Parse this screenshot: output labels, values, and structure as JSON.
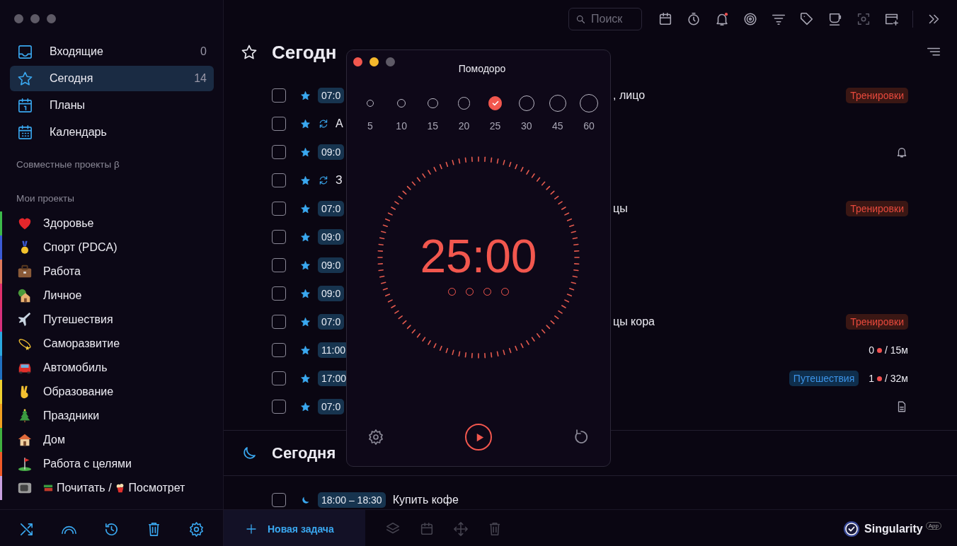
{
  "sidebar": {
    "nav": [
      {
        "label": "Входящие",
        "count": "0",
        "selected": false
      },
      {
        "label": "Сегодня",
        "count": "14",
        "selected": true
      },
      {
        "label": "Планы",
        "selected": false
      },
      {
        "label": "Календарь",
        "selected": false
      }
    ],
    "shared_label": "Совместные проекты β",
    "projects_label": "Мои проекты",
    "projects": [
      {
        "name": "Здоровье",
        "color": "#3cb94a"
      },
      {
        "name": "Спорт (PDCA)",
        "color": "#3b5bd6"
      },
      {
        "name": "Работа",
        "color": "#e07a5c"
      },
      {
        "name": "Личное",
        "color": "#e0306c"
      },
      {
        "name": "Путешествия",
        "color": "#d6307c"
      },
      {
        "name": "Саморазвитие",
        "color": "#2ba8e0"
      },
      {
        "name": "Автомобиль",
        "color": "#2070c0"
      },
      {
        "name": "Образование",
        "color": "#f0d030"
      },
      {
        "name": "Праздники",
        "color": "#f0a020"
      },
      {
        "name": "Дом",
        "color": "#40b040"
      },
      {
        "name": "Работа с целями",
        "color": "#f05a28"
      },
      {
        "name": "Посмотрет",
        "prefix": "Почитать /",
        "color": "#c8a0e0"
      }
    ]
  },
  "toolbar": {
    "search": {
      "placeholder": "Поиск"
    },
    "notifications_unread": true
  },
  "section": {
    "title": "Сегодн"
  },
  "tasks": [
    {
      "kind": "time",
      "checked": false,
      "lead": "07:0",
      "tail": ", лицо",
      "tag": {
        "label": "Тренировки",
        "color": "#3a1714"
      }
    },
    {
      "kind": "repeat",
      "checked": false,
      "lead": "А"
    },
    {
      "kind": "time",
      "checked": false,
      "lead": "09:0",
      "reminder": true
    },
    {
      "kind": "repeat",
      "checked": false,
      "lead": "З"
    },
    {
      "kind": "time",
      "checked": false,
      "lead": "07:0",
      "tail": "цы",
      "tag": {
        "label": "Тренировки",
        "color": "#3a1714"
      }
    },
    {
      "kind": "time",
      "checked": false,
      "lead": "09:0"
    },
    {
      "kind": "time",
      "checked": false,
      "lead": "09:0"
    },
    {
      "kind": "time",
      "checked": false,
      "lead": "09:0"
    },
    {
      "kind": "time",
      "checked": false,
      "lead": "07:0",
      "tail": "цы кора",
      "tag": {
        "label": "Тренировки",
        "color": "#3a1714"
      }
    },
    {
      "kind": "time",
      "checked": false,
      "lead": "11:00",
      "pomodoros": "0",
      "duration": "/ 15м"
    },
    {
      "kind": "time",
      "checked": false,
      "lead": "17:00",
      "tag": {
        "label": "Путешествия",
        "color": "#0f2e4c"
      },
      "pomodoros": "1",
      "duration": "/ 32м"
    },
    {
      "kind": "time",
      "checked": false,
      "lead": "07:0",
      "note": true
    }
  ],
  "evening": {
    "title": "Сегодня",
    "tasks": [
      {
        "time": "18:00 – 18:30",
        "title": "Купить кофе",
        "checked": false
      }
    ]
  },
  "bottom_bar": {
    "new_task": "Новая задача",
    "brand": "Singularity",
    "brand_badge": "App"
  },
  "pomodoro": {
    "title": "Помодоро",
    "durations": [
      {
        "label": "5",
        "selected": false
      },
      {
        "label": "10",
        "selected": false
      },
      {
        "label": "15",
        "selected": false
      },
      {
        "label": "20",
        "selected": false
      },
      {
        "label": "25",
        "selected": true
      },
      {
        "label": "30",
        "selected": false
      },
      {
        "label": "45",
        "selected": false
      },
      {
        "label": "60",
        "selected": false
      }
    ],
    "time": "25:00",
    "sessions": [
      {
        "done": false
      },
      {
        "done": false
      },
      {
        "done": false
      },
      {
        "done": false
      }
    ]
  }
}
